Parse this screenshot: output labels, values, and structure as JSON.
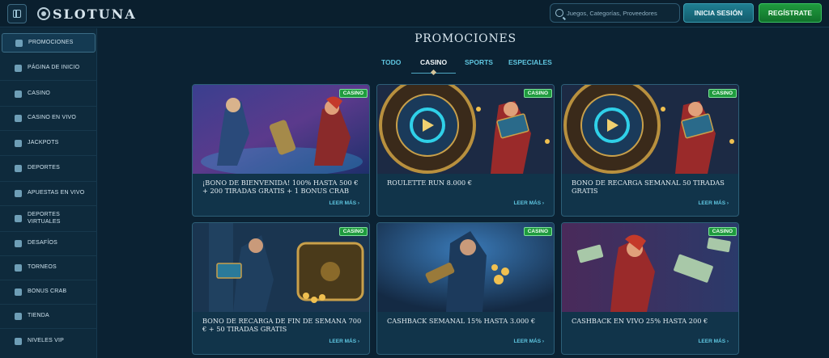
{
  "header": {
    "brand": "SLOTUNA",
    "search_placeholder": "Juegos, Categorías, Proveedores",
    "login_label": "INICIA SESIÓN",
    "register_label": "REGÍSTRATE"
  },
  "sidebar": {
    "items": [
      {
        "label": "PROMOCIONES",
        "icon": "gift-icon",
        "active": true
      },
      {
        "label": "PÁGINA DE INICIO",
        "icon": "castle-icon"
      },
      {
        "label": "CASINO",
        "icon": "slot-machine-icon"
      },
      {
        "label": "CASINO EN VIVO",
        "icon": "cards-icon"
      },
      {
        "label": "JACKPOTS",
        "icon": "clover-icon"
      },
      {
        "label": "DEPORTES",
        "icon": "soccer-ball-icon"
      },
      {
        "label": "APUESTAS EN VIVO",
        "icon": "screen-icon"
      },
      {
        "label": "DEPORTES VIRTUALES",
        "icon": "virtual-sports-icon"
      },
      {
        "label": "DESAFÍOS",
        "icon": "medal-icon"
      },
      {
        "label": "TORNEOS",
        "icon": "trophy-icon"
      },
      {
        "label": "BONUS CRAB",
        "icon": "crab-icon"
      },
      {
        "label": "TIENDA",
        "icon": "shop-icon"
      },
      {
        "label": "NIVELES VIP",
        "icon": "diamond-icon"
      }
    ]
  },
  "main": {
    "title": "PROMOCIONES",
    "tabs": [
      "TODO",
      "CASINO",
      "SPORTS",
      "ESPECIALES"
    ],
    "active_tab": "CASINO",
    "cards": [
      {
        "badge": "CASINO",
        "text": "¡BONO DE BIENVENIDA! 100% HASTA 500 € + 200 TIRADAS GRATIS + 1 BONUS CRAB",
        "link": "LEER MÁS ›"
      },
      {
        "badge": "CASINO",
        "text": "ROULETTE RUN 8.000 €",
        "link": "LEER MÁS ›"
      },
      {
        "badge": "CASINO",
        "text": "BONO DE RECARGA SEMANAL 50 TIRADAS GRATIS",
        "link": "LEER MÁS ›"
      },
      {
        "badge": "CASINO",
        "text": "BONO DE RECARGA DE FIN DE SEMANA 700 € + 50 TIRADAS GRATIS",
        "link": "LEER MÁS ›"
      },
      {
        "badge": "CASINO",
        "text": "CASHBACK SEMANAL 15% HASTA 3.000 €",
        "link": "LEER MÁS ›"
      },
      {
        "badge": "CASINO",
        "text": "CASHBACK EN VIVO 25% HASTA 200 €",
        "link": "LEER MÁS ›"
      }
    ]
  },
  "colors": {
    "background": "#0b2233",
    "sidebar": "#0e2a3c",
    "accent": "#5fc6e0",
    "login": "#1a7082",
    "register": "#1f9b3e",
    "badge": "#1f9b3e"
  }
}
